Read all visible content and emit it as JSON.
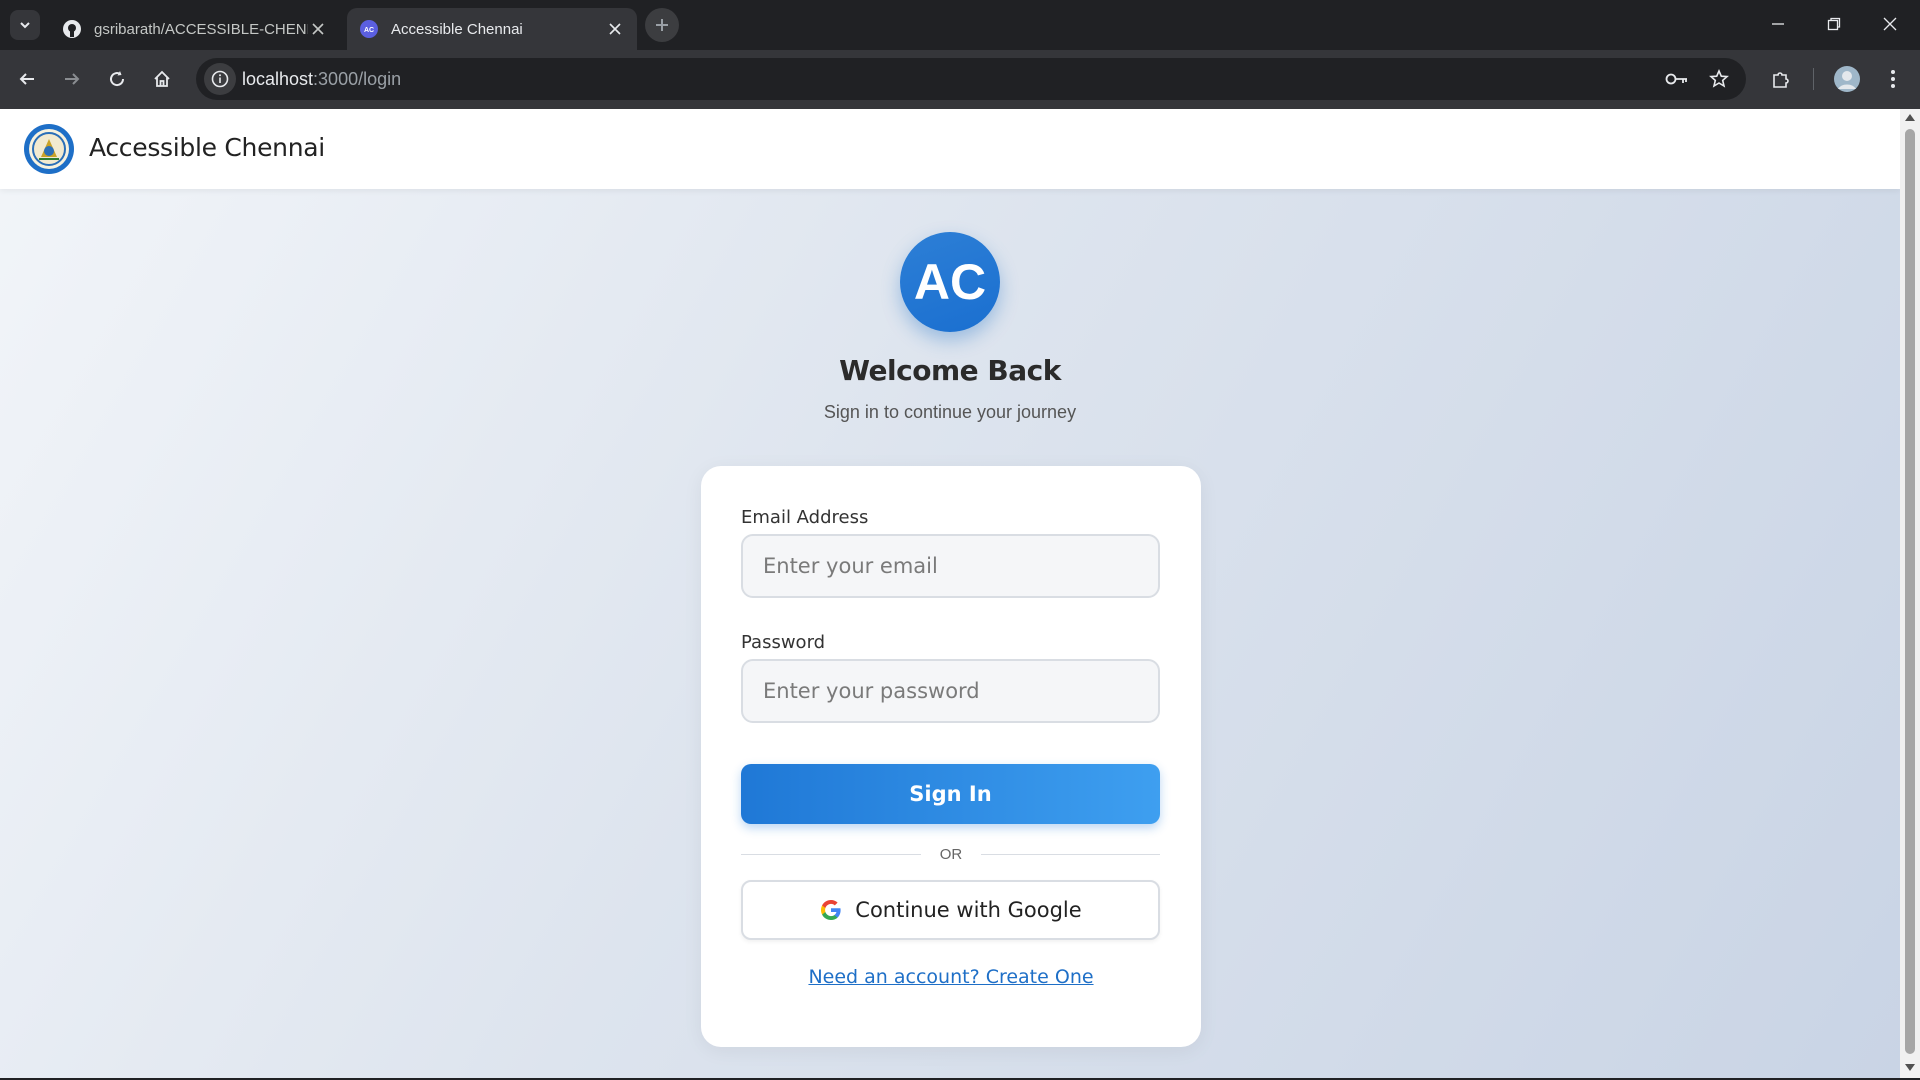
{
  "browser": {
    "tabs": [
      {
        "title": "gsribarath/ACCESSIBLE-CHENN",
        "active": false
      },
      {
        "title": "Accessible Chennai",
        "active": true
      }
    ],
    "url_host": "localhost",
    "url_path": ":3000/login"
  },
  "app": {
    "name": "Accessible Chennai"
  },
  "login": {
    "avatar_initials": "AC",
    "title": "Welcome Back",
    "subtitle": "Sign in to continue your journey",
    "email_label": "Email Address",
    "email_placeholder": "Enter your email",
    "email_value": "",
    "password_label": "Password",
    "password_placeholder": "Enter your password",
    "password_value": "",
    "signin_label": "Sign In",
    "divider_text": "OR",
    "google_label": "Continue with Google",
    "create_account_link": "Need an account? Create One"
  },
  "colors": {
    "accent": "#1e6fc7",
    "button_start": "#1f78d6",
    "button_end": "#3e9ff0"
  }
}
